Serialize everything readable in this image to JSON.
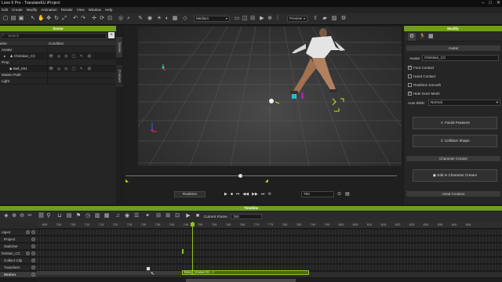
{
  "app": {
    "title": "Lone 6 Pro - TranslateEU.iProject",
    "window_controls": [
      "–",
      "□",
      "✕"
    ]
  },
  "menu": [
    "Edit",
    "Create",
    "Modify",
    "Animation",
    "Render",
    "View",
    "Window",
    "Help"
  ],
  "toolbar": {
    "quality_select": "Medium",
    "preview_select": "Preview"
  },
  "scene_panel": {
    "header": "Scene",
    "search_placeholder": "Search",
    "columns": [
      "ame",
      "Condition"
    ],
    "rows": [
      {
        "label": "Avatar"
      },
      {
        "label": "Christian_CC"
      },
      {
        "label": "Prop"
      },
      {
        "label": "Ball_001"
      },
      {
        "label": "Motion Path"
      },
      {
        "label": "Light"
      }
    ],
    "side_tabs": [
      "Scene",
      "Content"
    ]
  },
  "viewport": {
    "realtime_label": "Realtime",
    "frame_value": "750"
  },
  "modify_panel": {
    "header": "Modify",
    "section_avatar": "Avatar",
    "avatar_label": "Avatar",
    "avatar_value": "Christian_CC",
    "checkboxes": [
      {
        "label": "Foot Contact",
        "checked": true
      },
      {
        "label": "Hand Contact",
        "checked": false
      },
      {
        "label": "Realtime Smooth",
        "checked": false
      },
      {
        "label": "Hide Inner Mesh",
        "checked": true
      }
    ],
    "auto_blink_label": "Auto Blink:",
    "auto_blink_value": "Normal",
    "facial_features": "Facial Features",
    "collision_shape": "Collision Shape",
    "section_cc": "Character Creator",
    "edit_in_cc": "Edit in Character Creator",
    "section_head": "Head Creation"
  },
  "timeline": {
    "header": "Timeline",
    "current_frame_label": "Current Frame",
    "current_frame_value": "750",
    "ruler_ticks": [
      "695",
      "700",
      "705",
      "710",
      "715",
      "720",
      "725",
      "730",
      "735",
      "740",
      "745",
      "750",
      "755",
      "760",
      "765",
      "770",
      "775",
      "780",
      "785",
      "790",
      "795",
      "800",
      "805",
      "810",
      "815",
      "820",
      "825",
      "830",
      "835",
      "840",
      "845"
    ],
    "tracks": [
      "roject",
      "Project",
      "Switcher",
      "hristian_CC",
      "Collect Clip",
      "Transform",
      "Motion"
    ],
    "motion_clip_label": "Being_chased 01"
  },
  "colors": {
    "accent_green": "#8fc31f",
    "header_green": "#6f9e1f",
    "panel_bg": "#252525"
  }
}
